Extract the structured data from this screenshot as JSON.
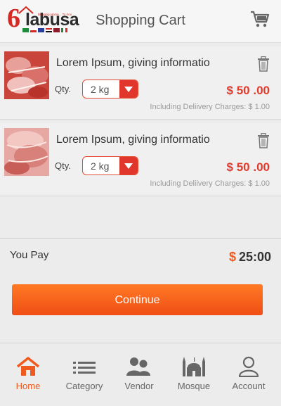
{
  "header": {
    "title": "Shopping Cart",
    "logo_text": "labusa",
    "logo_tagline": "Bringing Home... To You",
    "cart_icon": "shopping-cart-icon"
  },
  "cart": {
    "items": [
      {
        "name": "Lorem Ipsum, giving informatio",
        "qty_label": "Qty.",
        "qty_value": "2 kg",
        "price": "$ 50 .00",
        "delivery": "Including Deliivery Charges: $ 1.00",
        "thumb": "lamb-chops-image"
      },
      {
        "name": "Lorem Ipsum, giving informatio",
        "qty_label": "Qty.",
        "qty_value": "2 kg",
        "price": "$ 50 .00",
        "delivery": "Including Deliivery Charges: $ 1.00",
        "thumb": "raw-meat-image"
      }
    ]
  },
  "summary": {
    "label": "You Pay",
    "currency": "$",
    "amount": "25:00"
  },
  "actions": {
    "continue_label": "Continue"
  },
  "nav": {
    "items": [
      {
        "label": "Home",
        "icon": "home-icon",
        "active": true
      },
      {
        "label": "Category",
        "icon": "list-icon",
        "active": false
      },
      {
        "label": "Vendor",
        "icon": "vendor-icon",
        "active": false
      },
      {
        "label": "Mosque",
        "icon": "mosque-icon",
        "active": false
      },
      {
        "label": "Account",
        "icon": "user-icon",
        "active": false
      }
    ]
  },
  "colors": {
    "accent": "#ef5a1f",
    "price": "#e03a2c",
    "background": "#ececec"
  }
}
